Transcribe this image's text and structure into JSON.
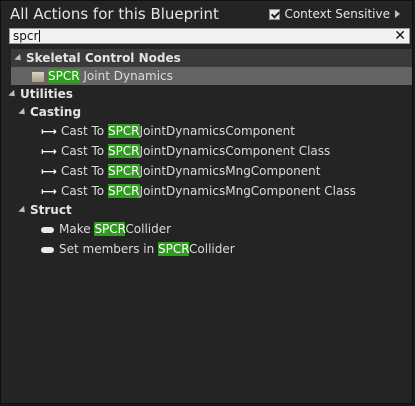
{
  "header": {
    "title": "All Actions for this Blueprint",
    "context_sensitive_label": "Context Sensitive",
    "context_sensitive_checked": true
  },
  "search": {
    "value": "spcr"
  },
  "highlight": "SPCR",
  "categories": [
    {
      "label": "Skeletal Control Nodes",
      "items": [
        {
          "match": "SPCR",
          "rest": " Joint Dynamics",
          "selected": true
        }
      ]
    },
    {
      "label": "Utilities",
      "subcategories": [
        {
          "label": "Casting",
          "items": [
            {
              "prefix": "Cast To ",
              "match": "SPCR",
              "rest": "JointDynamicsComponent"
            },
            {
              "prefix": "Cast To ",
              "match": "SPCR",
              "rest": "JointDynamicsComponent Class"
            },
            {
              "prefix": "Cast To ",
              "match": "SPCR",
              "rest": "JointDynamicsMngComponent"
            },
            {
              "prefix": "Cast To ",
              "match": "SPCR",
              "rest": "JointDynamicsMngComponent Class"
            }
          ]
        },
        {
          "label": "Struct",
          "items": [
            {
              "prefix": "Make ",
              "match": "SPCR",
              "rest": "Collider"
            },
            {
              "prefix": "Set members in ",
              "match": "SPCR",
              "rest": "Collider"
            }
          ]
        }
      ]
    }
  ],
  "colors": {
    "match_highlight": "#2f9e1f",
    "panel_bg": "#242424",
    "selected_row": "#646464"
  }
}
